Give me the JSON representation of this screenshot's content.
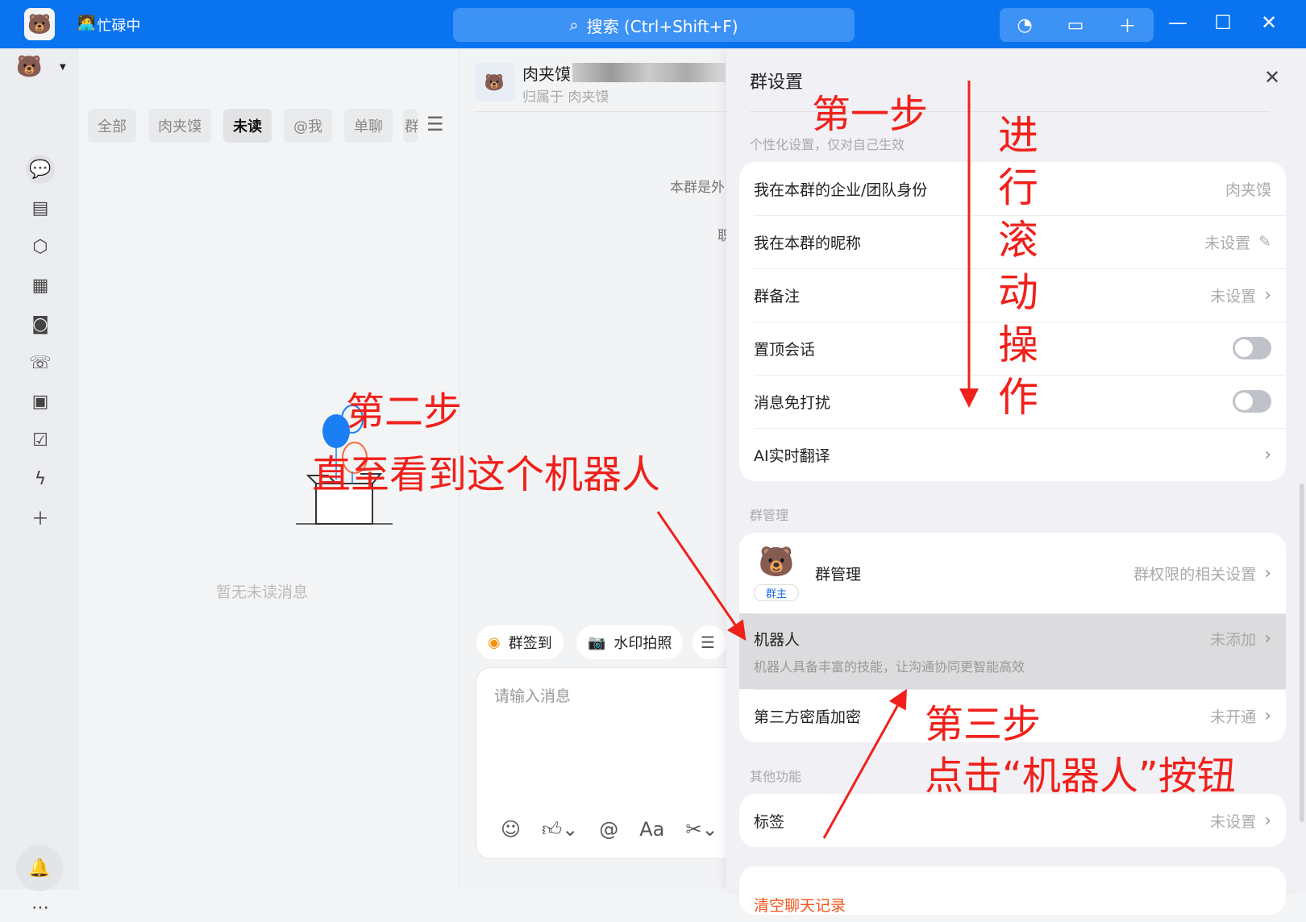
{
  "titlebar": {
    "status": "忙碌中",
    "search_placeholder": "搜索 (Ctrl+Shift+F)"
  },
  "filter_tabs": [
    "全部",
    "肉夹馍",
    "未读",
    "@我",
    "单聊",
    "群"
  ],
  "list": {
    "empty_text": "暂无未读消息"
  },
  "chat": {
    "name": "肉夹馍",
    "subtitle": "归属于 肉夹馍",
    "notice": "本群是外",
    "notice2": "职",
    "quick": [
      "群签到",
      "水印拍照"
    ],
    "input_placeholder": "请输入消息"
  },
  "panel": {
    "title": "群设置",
    "personal_label": "个性化设置，仅对自己生效",
    "personal_rows": [
      {
        "label": "我在本群的企业/团队身份",
        "value": "肉夹馍"
      },
      {
        "label": "我在本群的昵称",
        "value": "未设置"
      },
      {
        "label": "群备注",
        "value": "未设置"
      },
      {
        "label": "置顶会话",
        "value": ""
      },
      {
        "label": "消息免打扰",
        "value": ""
      },
      {
        "label": "AI实时翻译",
        "value": ""
      }
    ],
    "manage_label": "群管理",
    "manage": {
      "label": "群管理",
      "badge": "群主",
      "value": "群权限的相关设置"
    },
    "robot": {
      "label": "机器人",
      "value": "未添加",
      "desc": "机器人具备丰富的技能，让沟通协同更智能高效"
    },
    "cipher": {
      "label": "第三方密盾加密",
      "value": "未开通"
    },
    "other_label": "其他功能",
    "tag": {
      "label": "标签",
      "value": "未设置"
    },
    "clear": "清空聊天记录"
  },
  "annotations": {
    "step1": "第一步",
    "scroll": [
      "进",
      "行",
      "滚",
      "动",
      "操",
      "作"
    ],
    "step2": "第二步",
    "step2_desc": "直至看到这个机器人",
    "step3": "第三步",
    "step3_desc": "点击“机器人”按钮"
  }
}
